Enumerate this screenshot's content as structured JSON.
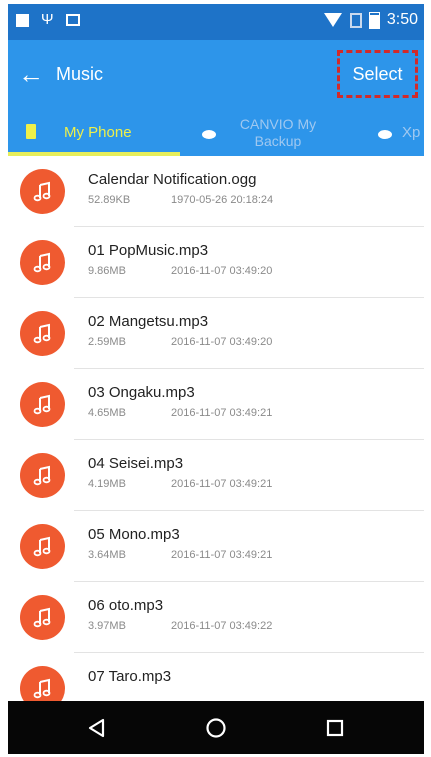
{
  "status_bar": {
    "time": "3:50",
    "icons": [
      "notification-square-icon",
      "usb-icon",
      "image-icon",
      "wifi-icon",
      "sim-icon",
      "battery-icon"
    ]
  },
  "app_bar": {
    "title": "Music",
    "select_label": "Select",
    "back_icon": "arrow-left-icon"
  },
  "tabs": [
    {
      "label": "My Phone",
      "icon": "phone-icon",
      "active": true
    },
    {
      "label": "CANVIO My Backup",
      "icon": "disk-icon",
      "active": false
    },
    {
      "label": "Xp",
      "icon": "disk-icon",
      "active": false
    }
  ],
  "files": [
    {
      "name": "Calendar Notification.ogg",
      "size": "52.89KB",
      "date": "1970-05-26 20:18:24"
    },
    {
      "name": "01 PopMusic.mp3",
      "size": "9.86MB",
      "date": "2016-11-07 03:49:20"
    },
    {
      "name": "02 Mangetsu.mp3",
      "size": "2.59MB",
      "date": "2016-11-07 03:49:20"
    },
    {
      "name": "03 Ongaku.mp3",
      "size": "4.65MB",
      "date": "2016-11-07 03:49:21"
    },
    {
      "name": "04 Seisei.mp3",
      "size": "4.19MB",
      "date": "2016-11-07 03:49:21"
    },
    {
      "name": "05 Mono.mp3",
      "size": "3.64MB",
      "date": "2016-11-07 03:49:21"
    },
    {
      "name": "06 oto.mp3",
      "size": "3.97MB",
      "date": "2016-11-07 03:49:22"
    },
    {
      "name": "07 Taro.mp3",
      "size": "",
      "date": ""
    }
  ],
  "colors": {
    "status_bar": "#1e73c8",
    "app_bar": "#2d95ea",
    "active_tab": "#eef04a",
    "music_icon": "#ef5a30",
    "highlight_box": "#d22a2a",
    "nav_bar": "#060606"
  },
  "nav_bar": {
    "icons": [
      "nav-back-icon",
      "nav-home-icon",
      "nav-recent-icon"
    ]
  }
}
